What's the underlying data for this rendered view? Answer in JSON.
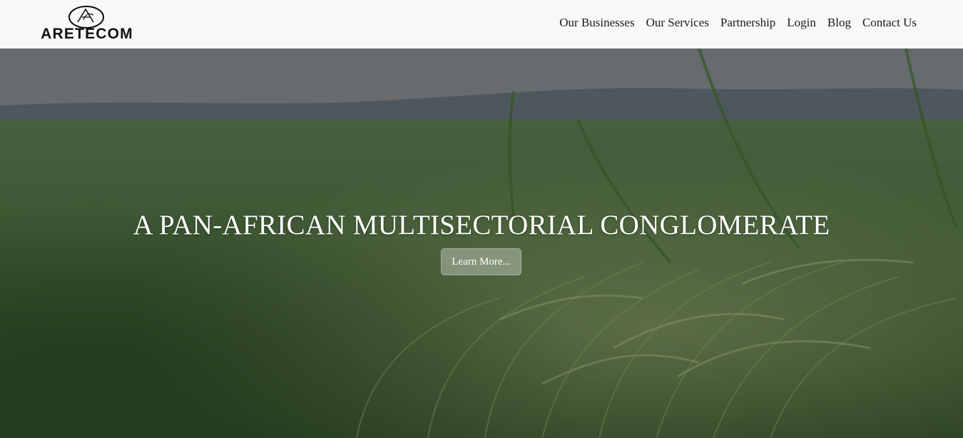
{
  "header": {
    "logo_text": "ARETECOM",
    "logo_mark_icon": "aretecom-emblem-icon",
    "nav": [
      {
        "label": "Our Businesses"
      },
      {
        "label": "Our Services"
      },
      {
        "label": "Partnership"
      },
      {
        "label": "Login"
      },
      {
        "label": "Blog"
      },
      {
        "label": "Contact Us"
      }
    ]
  },
  "hero": {
    "background_image": "rice-field-photo",
    "title": "A PAN-AFRICAN MULTISECTORIAL CONGLOMERATE",
    "button_label": "Learn More..."
  },
  "colors": {
    "header_bg": "#f7f8fa",
    "nav_text": "#1a1a1a",
    "hero_text": "#ffffff"
  }
}
